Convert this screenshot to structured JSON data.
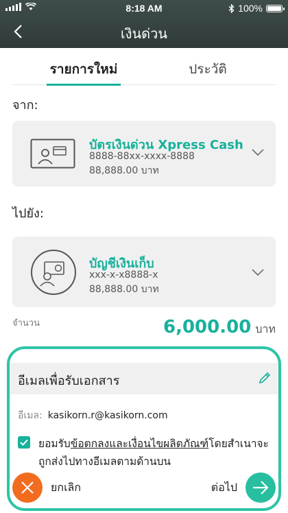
{
  "status_bar": {
    "time": "8:18 AM",
    "battery": "100%"
  },
  "header": {
    "title": "เงินด่วน"
  },
  "tabs": [
    {
      "label": "รายการใหม่"
    },
    {
      "label": "ประวัติ"
    }
  ],
  "from": {
    "label": "จาก:",
    "name": "บัตรเงินด่วน Xpress Cash",
    "number": "8888-88xx-xxxx-8888",
    "balance": "88,888.00 บาท"
  },
  "to": {
    "label": "ไปยัง:",
    "name": "บัญชีเงินเก็บ",
    "number": "xxx-x-x8888-x",
    "balance": "88,888.00 บาท"
  },
  "amount": {
    "label": "จำนวน",
    "value": "6,000.00",
    "unit": "บาท"
  },
  "email_section": {
    "title": "อีเมลเพื่อรับเอกสาร",
    "email_label": "อีเมล:",
    "email_value": "kasikorn.r@kasikorn.com",
    "consent_prefix": "ยอมรับ",
    "consent_link": "ข้อตกลงและเงื่อนไขผลิตภัณฑ์",
    "consent_suffix": "โดยสำเนาจะถูกส่งไปทางอีเมลตามด้านบน",
    "consent_checked": true
  },
  "actions": {
    "cancel": "ยกเลิก",
    "next": "ต่อไป"
  },
  "colors": {
    "accent": "#17b19c",
    "cancel": "#f26c1f",
    "header": "#34413f",
    "highlight_border": "#2ec4a5"
  }
}
